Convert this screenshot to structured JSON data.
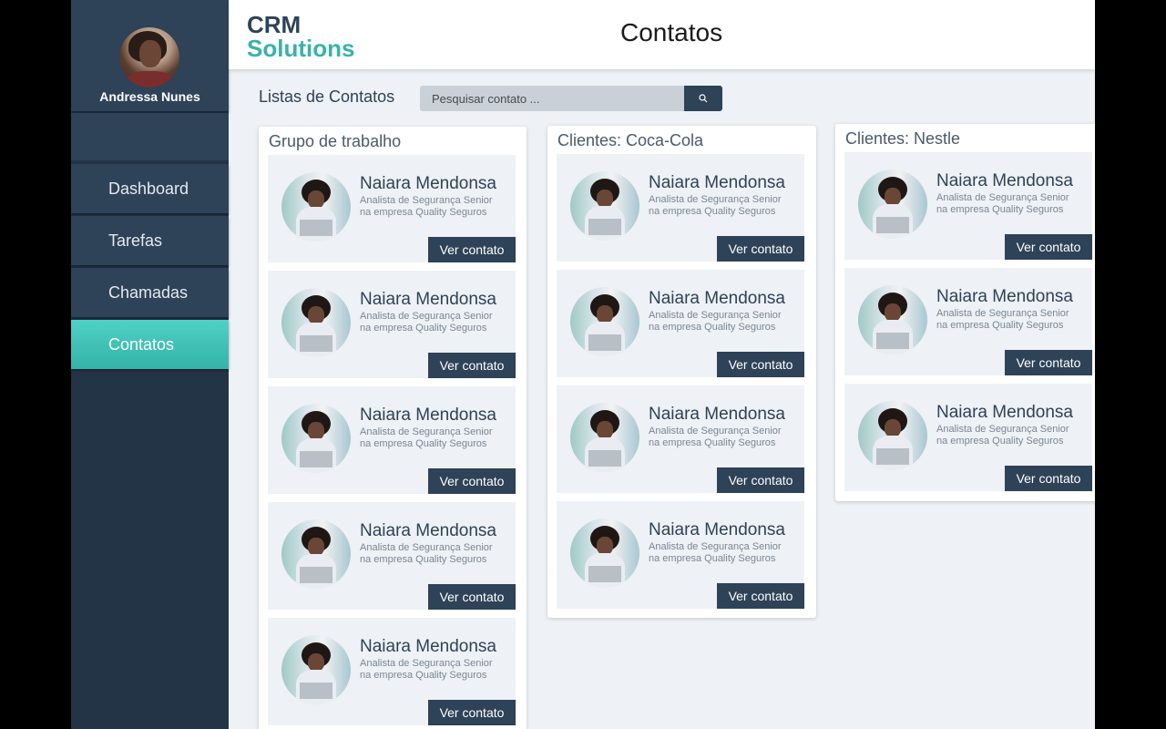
{
  "user": {
    "name": "Andressa Nunes"
  },
  "nav": [
    {
      "label": "Dashboard"
    },
    {
      "label": "Tarefas"
    },
    {
      "label": "Chamadas"
    },
    {
      "label": "Contatos"
    }
  ],
  "header": {
    "logo_line1": "CRM",
    "logo_line2": "Solutions",
    "title": "Contatos"
  },
  "toolbar": {
    "list_title": "Listas de Contatos",
    "search_placeholder": "Pesquisar contato ..."
  },
  "contact": {
    "name": "Naiara Mendonsa",
    "desc_line1": "Analista de Segurança Senior",
    "desc_line2": "na empresa Quality Seguros",
    "button_label": "Ver contato"
  },
  "columns": [
    {
      "title": "Grupo de trabalho",
      "cards": 5
    },
    {
      "title": "Clientes: Coca-Cola",
      "cards": 4
    },
    {
      "title": "Clientes: Nestle",
      "cards": 3
    }
  ],
  "colors": {
    "sidebar": "#243447",
    "accent": "#38b2ac",
    "primary": "#2e4258"
  }
}
